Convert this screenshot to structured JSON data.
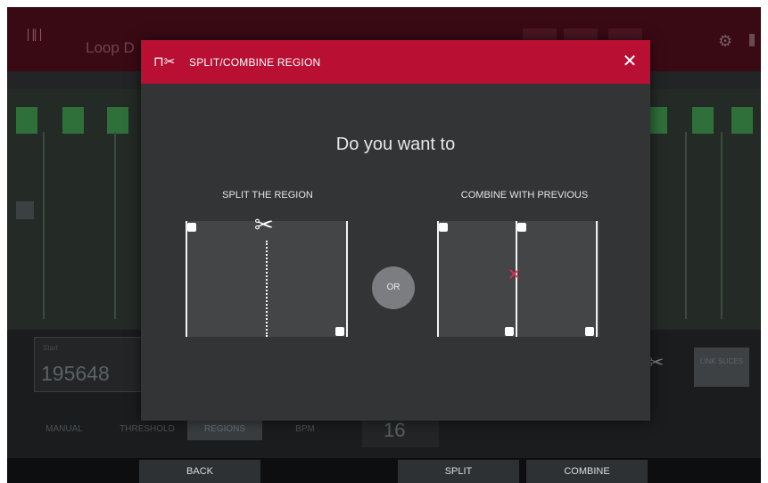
{
  "background": {
    "app_title": "Loop D",
    "start_label": "Start",
    "start_value": "195648",
    "modes": [
      "MANUAL",
      "THRESHOLD",
      "REGIONS",
      "BPM"
    ],
    "value": "16",
    "link_slices": "LINK SLICES"
  },
  "dialog": {
    "title": "SPLIT/COMBINE REGION",
    "question": "Do you want to",
    "split_label": "SPLIT THE REGION",
    "combine_label": "COMBINE WITH PREVIOUS",
    "or_label": "OR",
    "close_glyph": "✕",
    "scissors_glyph": "✂"
  },
  "footer": {
    "back": "BACK",
    "split": "SPLIT",
    "combine": "COMBINE"
  },
  "colors": {
    "accent": "#b80f33",
    "remove_marker": "#e0314e"
  }
}
